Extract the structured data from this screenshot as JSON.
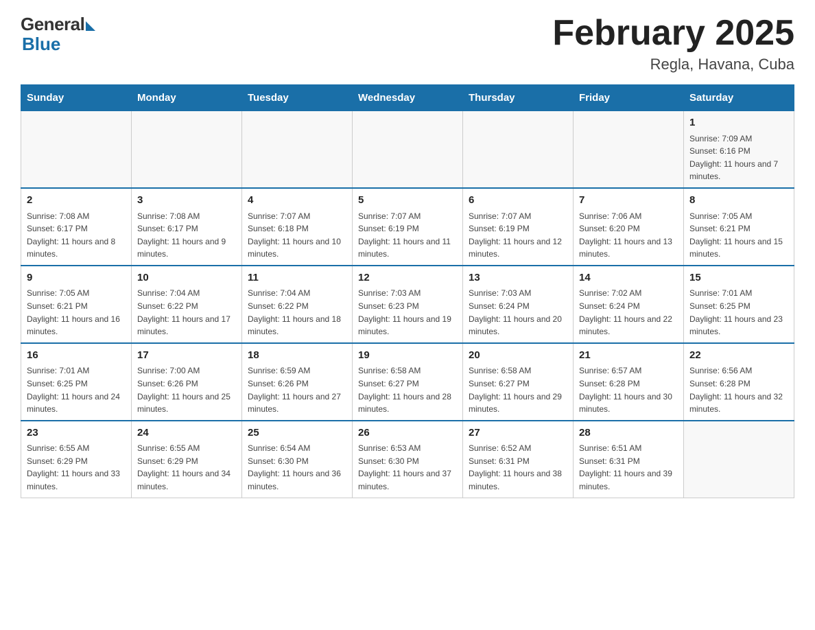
{
  "header": {
    "logo_general": "General",
    "logo_blue": "Blue",
    "title": "February 2025",
    "subtitle": "Regla, Havana, Cuba"
  },
  "weekdays": [
    "Sunday",
    "Monday",
    "Tuesday",
    "Wednesday",
    "Thursday",
    "Friday",
    "Saturday"
  ],
  "weeks": [
    [
      {
        "day": "",
        "sunrise": "",
        "sunset": "",
        "daylight": ""
      },
      {
        "day": "",
        "sunrise": "",
        "sunset": "",
        "daylight": ""
      },
      {
        "day": "",
        "sunrise": "",
        "sunset": "",
        "daylight": ""
      },
      {
        "day": "",
        "sunrise": "",
        "sunset": "",
        "daylight": ""
      },
      {
        "day": "",
        "sunrise": "",
        "sunset": "",
        "daylight": ""
      },
      {
        "day": "",
        "sunrise": "",
        "sunset": "",
        "daylight": ""
      },
      {
        "day": "1",
        "sunrise": "Sunrise: 7:09 AM",
        "sunset": "Sunset: 6:16 PM",
        "daylight": "Daylight: 11 hours and 7 minutes."
      }
    ],
    [
      {
        "day": "2",
        "sunrise": "Sunrise: 7:08 AM",
        "sunset": "Sunset: 6:17 PM",
        "daylight": "Daylight: 11 hours and 8 minutes."
      },
      {
        "day": "3",
        "sunrise": "Sunrise: 7:08 AM",
        "sunset": "Sunset: 6:17 PM",
        "daylight": "Daylight: 11 hours and 9 minutes."
      },
      {
        "day": "4",
        "sunrise": "Sunrise: 7:07 AM",
        "sunset": "Sunset: 6:18 PM",
        "daylight": "Daylight: 11 hours and 10 minutes."
      },
      {
        "day": "5",
        "sunrise": "Sunrise: 7:07 AM",
        "sunset": "Sunset: 6:19 PM",
        "daylight": "Daylight: 11 hours and 11 minutes."
      },
      {
        "day": "6",
        "sunrise": "Sunrise: 7:07 AM",
        "sunset": "Sunset: 6:19 PM",
        "daylight": "Daylight: 11 hours and 12 minutes."
      },
      {
        "day": "7",
        "sunrise": "Sunrise: 7:06 AM",
        "sunset": "Sunset: 6:20 PM",
        "daylight": "Daylight: 11 hours and 13 minutes."
      },
      {
        "day": "8",
        "sunrise": "Sunrise: 7:05 AM",
        "sunset": "Sunset: 6:21 PM",
        "daylight": "Daylight: 11 hours and 15 minutes."
      }
    ],
    [
      {
        "day": "9",
        "sunrise": "Sunrise: 7:05 AM",
        "sunset": "Sunset: 6:21 PM",
        "daylight": "Daylight: 11 hours and 16 minutes."
      },
      {
        "day": "10",
        "sunrise": "Sunrise: 7:04 AM",
        "sunset": "Sunset: 6:22 PM",
        "daylight": "Daylight: 11 hours and 17 minutes."
      },
      {
        "day": "11",
        "sunrise": "Sunrise: 7:04 AM",
        "sunset": "Sunset: 6:22 PM",
        "daylight": "Daylight: 11 hours and 18 minutes."
      },
      {
        "day": "12",
        "sunrise": "Sunrise: 7:03 AM",
        "sunset": "Sunset: 6:23 PM",
        "daylight": "Daylight: 11 hours and 19 minutes."
      },
      {
        "day": "13",
        "sunrise": "Sunrise: 7:03 AM",
        "sunset": "Sunset: 6:24 PM",
        "daylight": "Daylight: 11 hours and 20 minutes."
      },
      {
        "day": "14",
        "sunrise": "Sunrise: 7:02 AM",
        "sunset": "Sunset: 6:24 PM",
        "daylight": "Daylight: 11 hours and 22 minutes."
      },
      {
        "day": "15",
        "sunrise": "Sunrise: 7:01 AM",
        "sunset": "Sunset: 6:25 PM",
        "daylight": "Daylight: 11 hours and 23 minutes."
      }
    ],
    [
      {
        "day": "16",
        "sunrise": "Sunrise: 7:01 AM",
        "sunset": "Sunset: 6:25 PM",
        "daylight": "Daylight: 11 hours and 24 minutes."
      },
      {
        "day": "17",
        "sunrise": "Sunrise: 7:00 AM",
        "sunset": "Sunset: 6:26 PM",
        "daylight": "Daylight: 11 hours and 25 minutes."
      },
      {
        "day": "18",
        "sunrise": "Sunrise: 6:59 AM",
        "sunset": "Sunset: 6:26 PM",
        "daylight": "Daylight: 11 hours and 27 minutes."
      },
      {
        "day": "19",
        "sunrise": "Sunrise: 6:58 AM",
        "sunset": "Sunset: 6:27 PM",
        "daylight": "Daylight: 11 hours and 28 minutes."
      },
      {
        "day": "20",
        "sunrise": "Sunrise: 6:58 AM",
        "sunset": "Sunset: 6:27 PM",
        "daylight": "Daylight: 11 hours and 29 minutes."
      },
      {
        "day": "21",
        "sunrise": "Sunrise: 6:57 AM",
        "sunset": "Sunset: 6:28 PM",
        "daylight": "Daylight: 11 hours and 30 minutes."
      },
      {
        "day": "22",
        "sunrise": "Sunrise: 6:56 AM",
        "sunset": "Sunset: 6:28 PM",
        "daylight": "Daylight: 11 hours and 32 minutes."
      }
    ],
    [
      {
        "day": "23",
        "sunrise": "Sunrise: 6:55 AM",
        "sunset": "Sunset: 6:29 PM",
        "daylight": "Daylight: 11 hours and 33 minutes."
      },
      {
        "day": "24",
        "sunrise": "Sunrise: 6:55 AM",
        "sunset": "Sunset: 6:29 PM",
        "daylight": "Daylight: 11 hours and 34 minutes."
      },
      {
        "day": "25",
        "sunrise": "Sunrise: 6:54 AM",
        "sunset": "Sunset: 6:30 PM",
        "daylight": "Daylight: 11 hours and 36 minutes."
      },
      {
        "day": "26",
        "sunrise": "Sunrise: 6:53 AM",
        "sunset": "Sunset: 6:30 PM",
        "daylight": "Daylight: 11 hours and 37 minutes."
      },
      {
        "day": "27",
        "sunrise": "Sunrise: 6:52 AM",
        "sunset": "Sunset: 6:31 PM",
        "daylight": "Daylight: 11 hours and 38 minutes."
      },
      {
        "day": "28",
        "sunrise": "Sunrise: 6:51 AM",
        "sunset": "Sunset: 6:31 PM",
        "daylight": "Daylight: 11 hours and 39 minutes."
      },
      {
        "day": "",
        "sunrise": "",
        "sunset": "",
        "daylight": ""
      }
    ]
  ]
}
